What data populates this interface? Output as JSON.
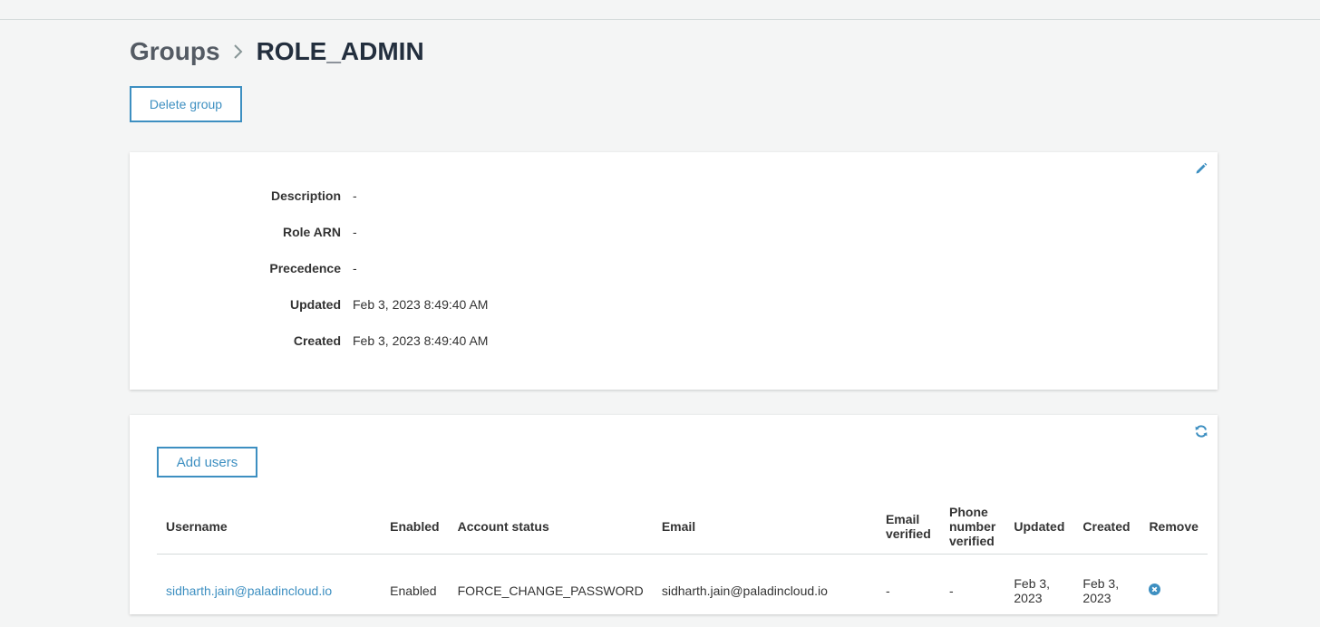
{
  "breadcrumb": {
    "parent": "Groups",
    "current": "ROLE_ADMIN"
  },
  "actions": {
    "delete_label": "Delete group"
  },
  "details": {
    "description_label": "Description",
    "description_value": "-",
    "role_arn_label": "Role ARN",
    "role_arn_value": "-",
    "precedence_label": "Precedence",
    "precedence_value": "-",
    "updated_label": "Updated",
    "updated_value": "Feb 3, 2023 8:49:40 AM",
    "created_label": "Created",
    "created_value": "Feb 3, 2023 8:49:40 AM"
  },
  "users": {
    "add_label": "Add users",
    "columns": {
      "username": "Username",
      "enabled": "Enabled",
      "account_status": "Account status",
      "email": "Email",
      "email_verified_1": "Email",
      "email_verified_2": "verified",
      "phone_verified_1": "Phone",
      "phone_verified_2": "number",
      "phone_verified_3": "verified",
      "updated": "Updated",
      "created": "Created",
      "remove": "Remove"
    },
    "rows": [
      {
        "username": "sidharth.jain@paladincloud.io",
        "enabled": "Enabled",
        "account_status": "FORCE_CHANGE_PASSWORD",
        "email": "sidharth.jain@paladincloud.io",
        "email_verified": "-",
        "phone_verified": "-",
        "updated_1": "Feb 3,",
        "updated_2": "2023",
        "created_1": "Feb 3,",
        "created_2": "2023"
      }
    ]
  },
  "colors": {
    "accent": "#3d8fc1",
    "background": "#f4f5f5",
    "panel": "#ffffff",
    "text": "#333333"
  },
  "icons": {
    "breadcrumb_separator": "chevron-right-icon",
    "edit": "pencil-icon",
    "refresh": "refresh-icon",
    "remove": "remove-circle-icon"
  }
}
